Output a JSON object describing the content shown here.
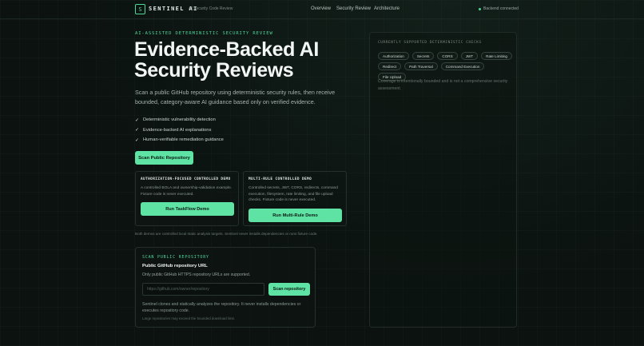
{
  "header": {
    "logo_glyph": "S",
    "brand": "SENTINEL AI",
    "subtitle": "AI Security Code Review",
    "nav": [
      "Overview",
      "Security Review",
      "Architecture"
    ],
    "status": "Backend connected",
    "status_color": "#4fd69a"
  },
  "hero": {
    "eyebrow": "AI-ASSISTED DETERMINISTIC SECURITY REVIEW",
    "title": "Evidence-Backed AI Security Reviews",
    "lead": "Scan a public GitHub repository using deterministic security rules, then receive bounded, category-aware AI guidance based only on verified evidence.",
    "features": [
      "Deterministic vulnerability detection",
      "Evidence-backed AI explanations",
      "Human-verifiable remediation guidance"
    ],
    "scan_button": "Scan Public Repository"
  },
  "demos": [
    {
      "title": "AUTHORIZATION-FOCUSED CONTROLLED DEMO",
      "description": "A controlled BOLA and ownership-validation example. Fixture code is never executed.",
      "button": "Run TaskFlow Demo"
    },
    {
      "title": "MULTI-RULE CONTROLLED DEMO",
      "description": "Controlled secrets, JWT, CORS, redirects, command execution, filesystem, rate limiting, and file upload checks. Fixture code is never executed.",
      "button": "Run Multi-Rule Demo"
    }
  ],
  "demo_note": "Both demos are controlled local static analysis targets. Sentinel never installs dependencies or runs fixture code.",
  "scan_panel": {
    "eyebrow": "SCAN PUBLIC REPOSITORY",
    "label": "Public GitHub repository URL",
    "help": "Only public GitHub HTTPS repository URLs are supported.",
    "input_value": "",
    "placeholder": "https://github.com/owner/repository",
    "button": "Scan repository",
    "description": "Sentinel clones and statically analyzes the repository. It never installs dependencies or executes repository code.",
    "small_note": "Large repositories may exceed the bounded download limit."
  },
  "checks_panel": {
    "title": "CURRENTLY SUPPORTED DETERMINISTIC CHECKS",
    "chips": [
      "Authorization",
      "Secrets",
      "CORS",
      "JWT",
      "Rate Limiting",
      "Redirect",
      "Path Traversal",
      "Command Execution",
      "File Upload"
    ],
    "note": "Coverage is intentionally bounded and is not a comprehensive security assessment."
  },
  "colors": {
    "accent": "#5ee3a4",
    "background": "#0b1210"
  }
}
